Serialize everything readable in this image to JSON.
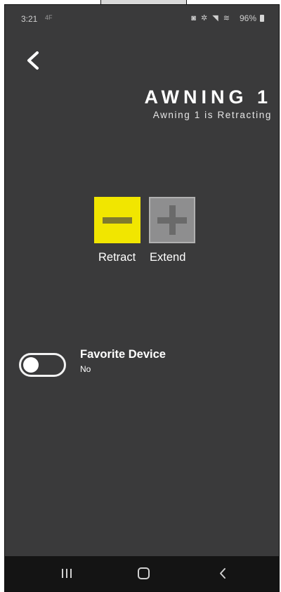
{
  "status_bar": {
    "time": "3:21",
    "time_extra": "4F",
    "icons": "◙ ✲ ◥ ≋",
    "battery": "96%"
  },
  "header": {
    "title": "AWNING 1",
    "status": "Awning 1 is Retracting"
  },
  "controls": {
    "retract_label": "Retract",
    "extend_label": "Extend",
    "active": "retract",
    "colors": {
      "active": "#f1e600",
      "inactive": "#8e8e8f"
    }
  },
  "favorite": {
    "title": "Favorite Device",
    "value": "No",
    "enabled": false
  },
  "nav": {
    "icons": [
      "recent-apps-icon",
      "home-icon",
      "back-icon"
    ]
  }
}
